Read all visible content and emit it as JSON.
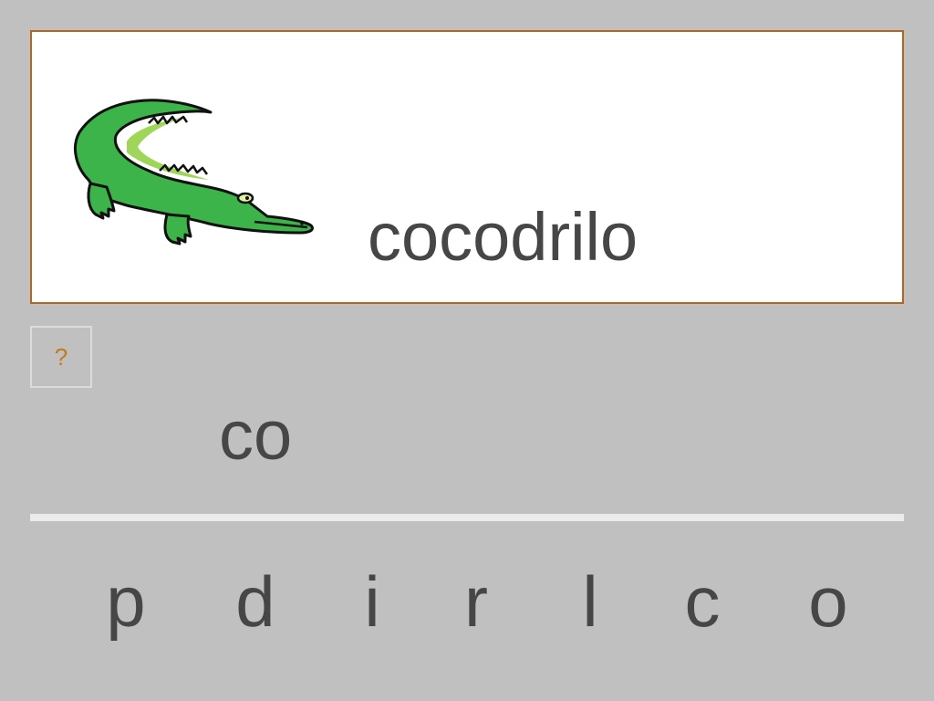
{
  "card": {
    "word": "cocodrilo",
    "image_icon": "crocodile-icon"
  },
  "help_button": {
    "label": "?"
  },
  "answer": {
    "typed": "co"
  },
  "letter_choices": [
    "p",
    "d",
    "i",
    "r",
    "l",
    "c",
    "o"
  ],
  "colors": {
    "background": "#c0c0c0",
    "card_border": "#b8651b",
    "text": "#464646",
    "help_accent": "#c5781e",
    "crocodile_green": "#3cb44a"
  }
}
